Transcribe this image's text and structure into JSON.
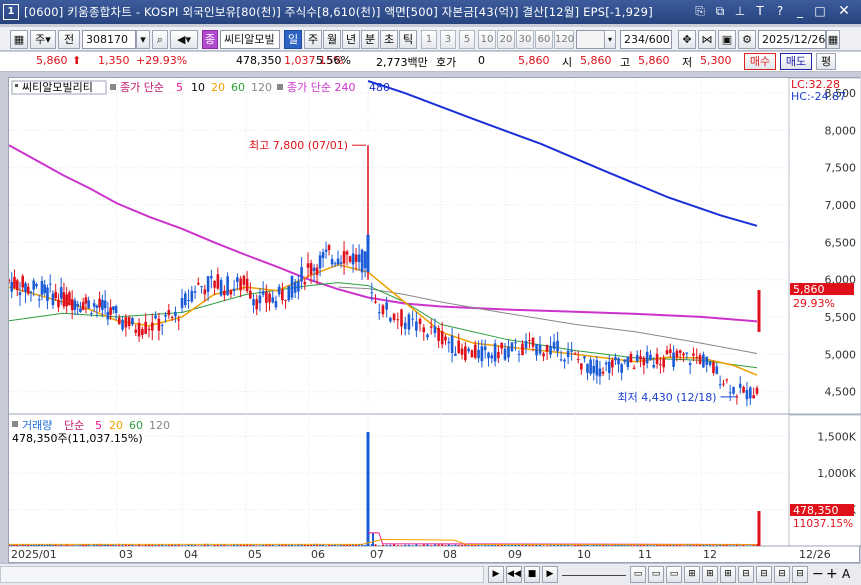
{
  "window": {
    "number": "1",
    "title": "[0600] 키움종합차트 - KOSPI 외국인보유[80(천)] 주식수[8,610(천)] 액면[500] 자본금[43(억)] 결산[12월] EPS[-1,929]"
  },
  "toolbar": {
    "market_label": "주",
    "tab_label": "전",
    "stock_code": "308170",
    "name_badge": "종",
    "stock_name": "씨티알모빌",
    "periods": [
      "일",
      "주",
      "월",
      "년",
      "분",
      "초",
      "틱"
    ],
    "active_period": "일",
    "intervals": [
      "1",
      "3",
      "5",
      "10",
      "20",
      "30",
      "60",
      "120"
    ],
    "count_value": "234",
    "count_total": "/600",
    "date": "2025/12/26"
  },
  "quote": {
    "price": "5,860",
    "change": "1,350",
    "change_pct": "+29.93%",
    "volume": "478,350",
    "volume_pct": "1,037.15%",
    "turnover_pct": "5.56%",
    "amount": "2,773백만",
    "hoga_label": "호가",
    "hoga_value": "0",
    "hoga_price": "5,860",
    "open_label": "시",
    "open": "5,860",
    "high_label": "고",
    "high": "5,860",
    "low_label": "저",
    "low": "5,300",
    "buy_label": "매수",
    "sell_label": "매도",
    "compare_label": "평"
  },
  "chart_data": {
    "type": "candlestick",
    "legend": {
      "name": "씨티알모빌리티",
      "ma_label": "종가 단순",
      "ma_periods": [
        "5",
        "10",
        "20",
        "60",
        "120"
      ],
      "ma_colors": [
        "#e8188c",
        "#0a0a0a",
        "#f0a000",
        "#2e9e3e",
        "#888888"
      ],
      "ma240_label": "종가 단순 240",
      "ma240_color": "#cc33cc",
      "ma480_label": "480",
      "ma480_color": "#1a2fd6"
    },
    "price_axis": {
      "ticks": [
        4500,
        5000,
        5500,
        6000,
        6500,
        7000,
        7500,
        8000,
        8500
      ],
      "ylim": [
        4200,
        8700
      ]
    },
    "price_labels": [
      "4,500",
      "5,000",
      "5,500",
      "6,000",
      "6,500",
      "7,000",
      "7,500",
      "8,000",
      "8,500"
    ],
    "lc": "LC:32.28",
    "hc": "HC:-24.87",
    "current_price_label": "5,860",
    "current_pct_label": "29.93%",
    "annotations": {
      "high": {
        "text": "최고 7,800 (07/01)",
        "value": 7800
      },
      "low": {
        "text": "최저 4,430 (12/18)",
        "value": 4430
      }
    },
    "x_labels": [
      "2025/01",
      "03",
      "04",
      "05",
      "06",
      "07",
      "08",
      "09",
      "10",
      "11",
      "12",
      "12/26"
    ],
    "volume": {
      "legend_label": "거래량",
      "ma_label": "단순",
      "ma_periods": [
        "5",
        "20",
        "60",
        "120"
      ],
      "ma_colors": [
        "#e8188c",
        "#f0a000",
        "#2e9e3e",
        "#888888"
      ],
      "current_text": "478,350주(11,037.15%)",
      "ticks": [
        500000,
        1000000,
        1500000
      ],
      "tick_labels": [
        "500K",
        "1,000K",
        "1,500K"
      ],
      "ylim": [
        0,
        1600000
      ],
      "current_value_label": "478,350",
      "current_pct_label": "11037.15%"
    },
    "ma480": [
      [
        7.0,
        8660
      ],
      [
        7.5,
        8500
      ],
      [
        8.5,
        8150
      ],
      [
        9.5,
        7820
      ],
      [
        10.5,
        7450
      ],
      [
        11.5,
        7100
      ],
      [
        12.3,
        6860
      ],
      [
        12.85,
        6720
      ]
    ],
    "ma240": [
      [
        1.0,
        7800
      ],
      [
        1.5,
        7600
      ],
      [
        2.0,
        7400
      ],
      [
        2.5,
        7220
      ],
      [
        3.0,
        7020
      ],
      [
        3.5,
        6840
      ],
      [
        4.0,
        6680
      ],
      [
        4.5,
        6500
      ],
      [
        5.0,
        6330
      ],
      [
        5.5,
        6170
      ],
      [
        6.0,
        6000
      ],
      [
        6.5,
        5870
      ],
      [
        7.0,
        5760
      ],
      [
        7.5,
        5680
      ],
      [
        8.0,
        5640
      ],
      [
        9.0,
        5600
      ],
      [
        10.0,
        5570
      ],
      [
        11.0,
        5540
      ],
      [
        12.0,
        5500
      ],
      [
        12.85,
        5440
      ]
    ],
    "ma120": [
      [
        6.5,
        5900
      ],
      [
        7.0,
        5880
      ],
      [
        7.5,
        5800
      ],
      [
        8.0,
        5700
      ],
      [
        9.0,
        5550
      ],
      [
        10.0,
        5400
      ],
      [
        11.0,
        5300
      ],
      [
        12.0,
        5150
      ],
      [
        12.85,
        5010
      ]
    ],
    "ma60": [
      [
        1.0,
        5450
      ],
      [
        2.0,
        5550
      ],
      [
        3.0,
        5500
      ],
      [
        4.0,
        5560
      ],
      [
        5.0,
        5800
      ],
      [
        6.0,
        5920
      ],
      [
        6.5,
        5960
      ],
      [
        7.0,
        5920
      ],
      [
        7.5,
        5700
      ],
      [
        8.0,
        5400
      ],
      [
        9.0,
        5200
      ],
      [
        10.0,
        5050
      ],
      [
        11.0,
        4950
      ],
      [
        12.0,
        4920
      ],
      [
        12.85,
        4820
      ]
    ],
    "ma20": [
      [
        1.0,
        5900
      ],
      [
        1.5,
        5800
      ],
      [
        2.0,
        5700
      ],
      [
        2.5,
        5600
      ],
      [
        3.0,
        5450
      ],
      [
        3.5,
        5380
      ],
      [
        4.0,
        5500
      ],
      [
        4.5,
        5800
      ],
      [
        5.0,
        5900
      ],
      [
        5.5,
        5850
      ],
      [
        6.0,
        6050
      ],
      [
        6.5,
        6200
      ],
      [
        7.0,
        6100
      ],
      [
        7.5,
        5700
      ],
      [
        8.0,
        5300
      ],
      [
        8.5,
        5150
      ],
      [
        9.0,
        5100
      ],
      [
        9.5,
        5050
      ],
      [
        10.0,
        5000
      ],
      [
        10.5,
        4950
      ],
      [
        11.0,
        4900
      ],
      [
        11.5,
        4960
      ],
      [
        12.0,
        4950
      ],
      [
        12.5,
        4850
      ],
      [
        12.85,
        4720
      ]
    ]
  },
  "bottom": {
    "date_label": "12/26"
  }
}
